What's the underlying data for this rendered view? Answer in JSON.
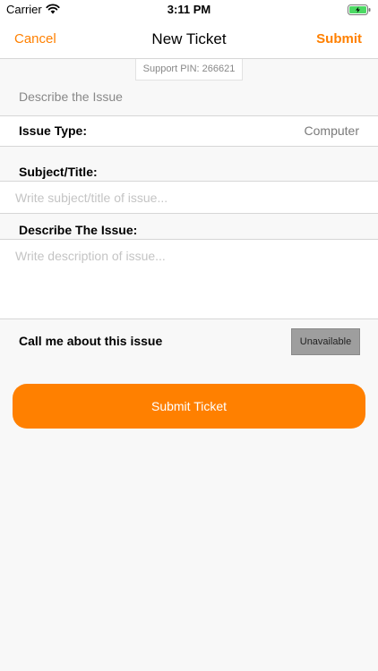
{
  "status_bar": {
    "carrier": "Carrier",
    "time": "3:11 PM"
  },
  "nav": {
    "cancel_label": "Cancel",
    "title": "New Ticket",
    "submit_label": "Submit"
  },
  "support_pin": "Support PIN: 266621",
  "form": {
    "section_header": "Describe the Issue",
    "issue_type_label": "Issue Type:",
    "issue_type_value": "Computer",
    "subject_label": "Subject/Title:",
    "subject_placeholder": "Write subject/title of issue...",
    "describe_label": "Describe The Issue:",
    "describe_placeholder": "Write description of issue...",
    "call_label": "Call me about this issue",
    "call_button": "Unavailable"
  },
  "submit_ticket_label": "Submit Ticket",
  "colors": {
    "accent": "#ff8000",
    "disabled": "#9e9e9e"
  },
  "icons": {
    "wifi": "wifi-icon",
    "battery": "battery-charging-icon"
  }
}
